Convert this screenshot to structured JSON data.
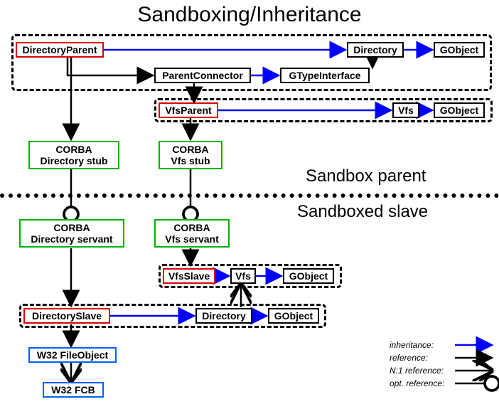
{
  "title": "Sandboxing/Inheritance",
  "sections": {
    "parent": "Sandbox parent",
    "slave": "Sandboxed slave"
  },
  "nodes": {
    "directoryParent": "DirectoryParent",
    "directory1": "Directory",
    "gobject1": "GObject",
    "parentConnector": "ParentConnector",
    "gtypeInterface": "GTypeInterface",
    "vfsParent": "VfsParent",
    "vfs1": "Vfs",
    "gobject2": "GObject",
    "corbaDirStub": "CORBA\nDirectory stub",
    "corbaVfsStub": "CORBA\nVfs stub",
    "corbaDirServant": "CORBA\nDirectory servant",
    "corbaVfsServant": "CORBA\nVfs servant",
    "vfsSlave": "VfsSlave",
    "vfs2": "Vfs",
    "gobject3": "GObject",
    "directorySlave": "DirectorySlave",
    "directory2": "Directory",
    "gobject4": "GObject",
    "w32FileObject": "W32 FileObject",
    "w32FCB": "W32 FCB"
  },
  "legend": {
    "inheritance": "inheritance:",
    "reference": "reference:",
    "n1ref": "N:1 reference:",
    "optref": "opt. reference:"
  }
}
